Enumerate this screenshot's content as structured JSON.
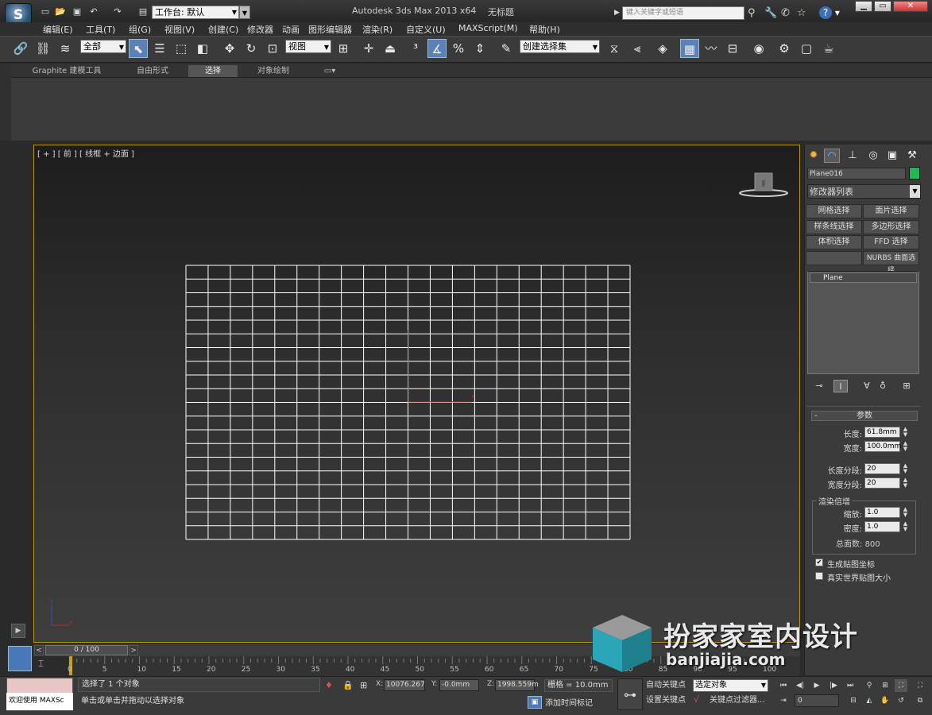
{
  "app": {
    "logo_letter": "S",
    "workspace_label": "工作台: 默认",
    "title": "Autodesk 3ds Max  2013 x64",
    "document": "无标题",
    "search_placeholder": "键入关键字或短语",
    "help_label": "?"
  },
  "menu": [
    "编辑(E)",
    "工具(T)",
    "组(G)",
    "视图(V)",
    "创建(C)",
    "修改器",
    "动画",
    "图形编辑器",
    "渲染(R)",
    "自定义(U)",
    "MAXScript(M)",
    "帮助(H)"
  ],
  "toolbar": {
    "filter_value": "全部",
    "refcoord_value": "视图",
    "named_selection_value": "创建选择集"
  },
  "ribbon": {
    "tabs": [
      "Graphite 建模工具",
      "自由形式",
      "选择",
      "对象绘制"
    ],
    "active_tab": 2
  },
  "viewport": {
    "label": "[ + ] [ 前 ] [ 线框 + 边面 ]",
    "grid_rows": 20,
    "grid_cols": 20,
    "accent": "#b8960c"
  },
  "command_panel": {
    "object_name": "Plane016",
    "object_color": "#1db954",
    "modifier_list": "修改器列表",
    "modifier_buttons": [
      "网格选择",
      "面片选择",
      "样条线选择",
      "多边形选择",
      "体积选择",
      "FFD 选择",
      "",
      "NURBS 曲面选择"
    ],
    "stack_item": "Plane",
    "rollout_title": "参数",
    "params": [
      {
        "label": "长度:",
        "value": "61.8mm"
      },
      {
        "label": "宽度:",
        "value": "100.0mm"
      },
      {
        "label": "长度分段:",
        "value": "20"
      },
      {
        "label": "宽度分段:",
        "value": "20"
      }
    ],
    "render_group_title": "渲染倍增",
    "render_params": [
      {
        "label": "缩放:",
        "value": "1.0"
      },
      {
        "label": "密度:",
        "value": "1.0"
      }
    ],
    "total_faces_label": "总面数:",
    "total_faces": "800",
    "gen_mapping": "生成贴图坐标",
    "real_world": "真实世界贴图大小"
  },
  "timeline": {
    "frame_display": "0 / 100",
    "ticks": [
      "0",
      "5",
      "10",
      "15",
      "20",
      "25",
      "30",
      "35",
      "40",
      "45",
      "50",
      "55",
      "60",
      "65",
      "70",
      "75",
      "80",
      "85",
      "90",
      "95",
      "100"
    ]
  },
  "status": {
    "maxscript_label": "欢迎使用 MAXSc",
    "selected_text": "选择了 1 个对象",
    "prompt_text": "单击或单击并拖动以选择对象",
    "x_label": "X:",
    "x_value": "10076.267",
    "y_label": "Y:",
    "y_value": "-0.0mm",
    "z_label": "Z:",
    "z_value": "1998.559m",
    "grid_text": "栅格 = 10.0mm",
    "add_time_tag": "添加时间标记",
    "auto_key": "自动关键点",
    "set_key": "设置关键点",
    "selection_set": "选定对象",
    "key_filters": "关键点过滤器...",
    "frame_value": "0"
  },
  "watermark": {
    "text": "扮家家室内设计",
    "url": "banjiajia.com"
  }
}
